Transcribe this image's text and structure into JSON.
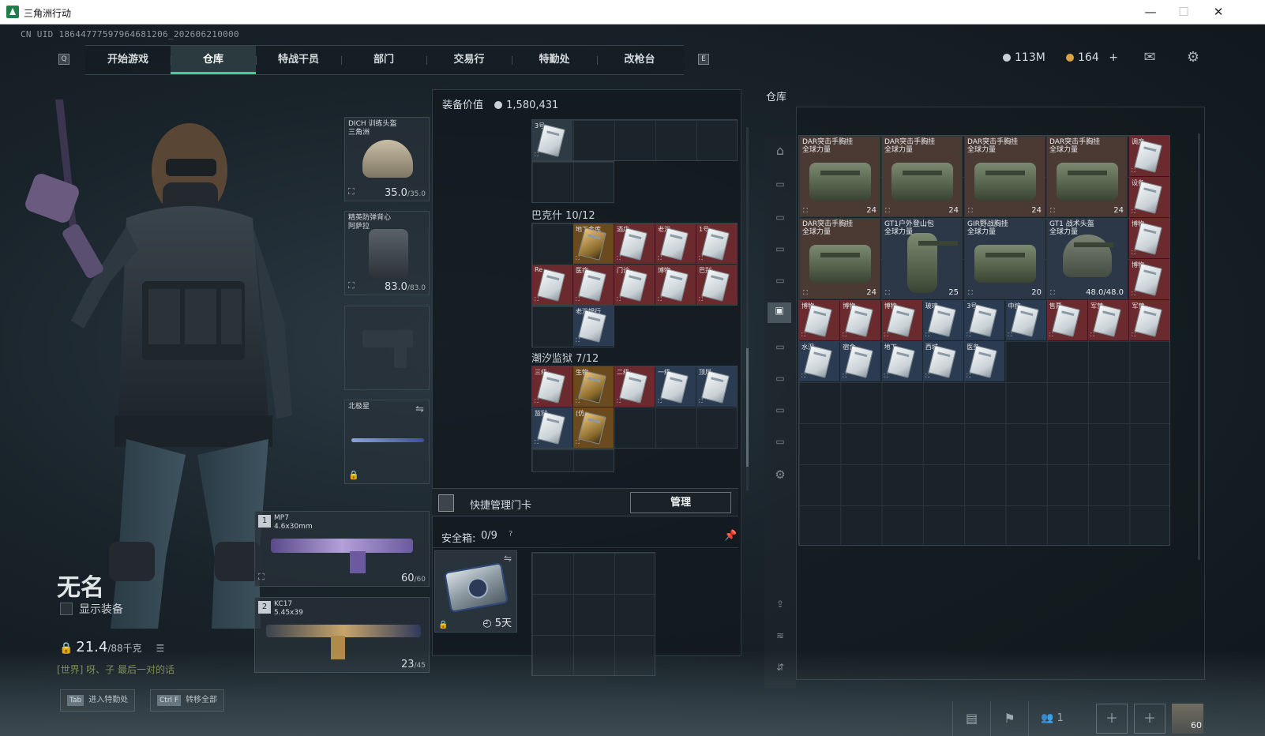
{
  "window": {
    "title": "三角洲行动",
    "min": "—",
    "max": "☐",
    "close": "✕"
  },
  "uid": "CN UID 18644777597964681206_202606210000",
  "nav": {
    "left_key": "Q",
    "tabs": [
      "开始游戏",
      "仓库",
      "特战干员",
      "部门",
      "交易行",
      "特勤处",
      "改枪台"
    ],
    "active_tab": 1,
    "right_key": "E"
  },
  "currency": {
    "silver": "113M",
    "gold": "164",
    "plus": "+",
    "silver_color": "#c9d1d6",
    "gold_color": "#d9a441"
  },
  "icons": {
    "mail": "mail-icon",
    "settings": "gear-icon"
  },
  "character": {
    "name": "无名",
    "show_equipment": "显示装备",
    "weight_value": "21.4",
    "weight_max": "/88千克",
    "chat": "[世界] 呀、子 最后一对的话"
  },
  "hints": [
    {
      "key": "Tab",
      "label": "进入特勤处"
    },
    {
      "key": "Ctrl F",
      "label": "转移全部"
    }
  ],
  "equipment": {
    "helmet": {
      "name": "DICH 训练头盔",
      "sub": "三角洲",
      "dur": "35.0",
      "max": "/35.0"
    },
    "armor": {
      "name": "精英防弹背心",
      "sub": "阿萨拉",
      "dur": "83.0",
      "max": "/83.0"
    },
    "melee": {
      "name": "北极星"
    },
    "weapon1": {
      "slot": "1",
      "name": "MP7",
      "caliber": "4.6x30mm",
      "ammo": "60",
      "ammo_max": "/60"
    },
    "weapon2": {
      "slot": "2",
      "name": "KC17",
      "caliber": "5.45x39",
      "ammo": "23",
      "ammo_max": "/45"
    }
  },
  "loadout": {
    "value_label": "装备价值",
    "value": "1,580,431",
    "top_card": "3号",
    "group1": {
      "title": "巴克什 10/12",
      "cards": [
        {
          "t": "",
          "c": "empty"
        },
        {
          "t": "地下金库",
          "c": "gold"
        },
        {
          "t": "酒店",
          "c": "red"
        },
        {
          "t": "老浴",
          "c": "red"
        },
        {
          "t": "1号",
          "c": "red"
        },
        {
          "t": "Re",
          "c": "red"
        },
        {
          "t": "医疗",
          "c": "red"
        },
        {
          "t": "门诊",
          "c": "red"
        },
        {
          "t": "博物",
          "c": "red"
        },
        {
          "t": "巴别",
          "c": "red"
        },
        {
          "t": "",
          "c": "empty"
        },
        {
          "t": "老浴银行",
          "c": "blue"
        }
      ]
    },
    "group2": {
      "title": "潮汐监狱 7/12",
      "cards": [
        {
          "t": "三级",
          "c": "red"
        },
        {
          "t": "生物",
          "c": "gold"
        },
        {
          "t": "二级",
          "c": "red"
        },
        {
          "t": "一级",
          "c": "blue"
        },
        {
          "t": "顶层",
          "c": "blue"
        },
        {
          "t": "监狱",
          "c": "blue"
        },
        {
          "t": "(仿",
          "c": "gold"
        }
      ]
    },
    "quick_card": "快捷管理门卡",
    "manage_btn": "管理",
    "safe_label": "安全箱:",
    "safe_count": "0/9",
    "safe_q": "?",
    "safe_days": "5天"
  },
  "warehouse": {
    "title": "仓库",
    "bags": [
      {
        "name": "DAR突击手胸挂",
        "sub": "全球力量",
        "count": "24",
        "shape": "rig",
        "c": "brown"
      },
      {
        "name": "DAR突击手胸挂",
        "sub": "全球力量",
        "count": "24",
        "shape": "rig",
        "c": "brown"
      },
      {
        "name": "DAR突击手胸挂",
        "sub": "全球力量",
        "count": "24",
        "shape": "rig",
        "c": "brown"
      },
      {
        "name": "DAR突击手胸挂",
        "sub": "全球力量",
        "count": "24",
        "shape": "rig",
        "c": "brown"
      },
      {
        "name": "DAR突击手胸挂",
        "sub": "全球力量",
        "count": "24",
        "shape": "rig",
        "c": "brown"
      },
      {
        "name": "GT1户外登山包",
        "sub": "全球力量",
        "count": "25",
        "shape": "pack",
        "c": "blue"
      },
      {
        "name": "GIR野战胸挂",
        "sub": "全球力量",
        "count": "20",
        "shape": "rig",
        "c": "blue"
      },
      {
        "name": "GT1 战术头盔",
        "sub": "全球力量",
        "count": "48.0/48.0",
        "shape": "helm",
        "c": "blue"
      }
    ],
    "side_cards": [
      "调度",
      "设备",
      "博物",
      "博物"
    ],
    "row3": [
      {
        "t": "博物",
        "c": "red"
      },
      {
        "t": "博物",
        "c": "red"
      },
      {
        "t": "博物",
        "c": "red"
      },
      {
        "t": "玻璃",
        "c": "blue"
      },
      {
        "t": "3号",
        "c": "blue"
      },
      {
        "t": "中控",
        "c": "blue"
      },
      {
        "t": "售票",
        "c": "red"
      },
      {
        "t": "军营",
        "c": "red"
      },
      {
        "t": "军营",
        "c": "red"
      }
    ],
    "row4": [
      {
        "t": "水泥",
        "c": "blue"
      },
      {
        "t": "宿舍",
        "c": "blue"
      },
      {
        "t": "地下",
        "c": "blue"
      },
      {
        "t": "西城",
        "c": "blue"
      },
      {
        "t": "医务",
        "c": "blue"
      }
    ]
  },
  "bottom": {
    "friends": "1",
    "level": "60"
  }
}
